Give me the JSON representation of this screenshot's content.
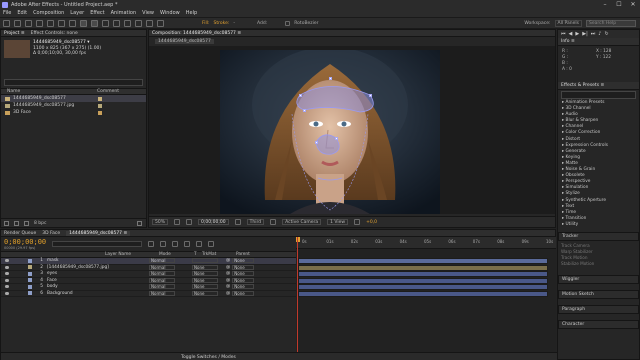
{
  "app": {
    "title": "Adobe After Effects - Untitled Project.aep *",
    "window_controls": [
      "–",
      "☐",
      "✕"
    ]
  },
  "menu": [
    "File",
    "Edit",
    "Composition",
    "Layer",
    "Effect",
    "Animation",
    "View",
    "Window",
    "Help"
  ],
  "toolbar": {
    "fill_label": "Fill:",
    "stroke_label": "Stroke:",
    "stroke_value": "-",
    "add_label": "Add:",
    "rotobezier_label": "RotoBezier",
    "workspace_label": "Workspace:",
    "workspace_value": "All Panels",
    "search_placeholder": "Search Help"
  },
  "project_panel": {
    "tabs": [
      "Project ≡",
      "Effect Controls: none"
    ],
    "selected_name": "1444685949_dsc08577 ▾",
    "selected_info1": "1100 x 825  (367 x 275) (1.00)",
    "selected_info2": "Δ 0;00;10;00, 30,00 fps",
    "col_name": "Name",
    "col_comment": "Comment",
    "items": [
      {
        "name": "1444685949_dsc08577",
        "color": "#c9b27a",
        "selected": true
      },
      {
        "name": "1444685949_dsc08577.jpg",
        "color": "#b6a87a",
        "selected": false
      },
      {
        "name": "3D Face",
        "color": "#c9a05a",
        "selected": false
      }
    ],
    "footer_bpc": "8 bpc"
  },
  "composition_panel": {
    "tab": "Composition: 1444685949_dsc08577 ≡",
    "subtab": "1444685949_dsc08577",
    "zoom": "50%",
    "timecode": "0;00;00;00",
    "resolution": "Third",
    "camera": "Active Camera",
    "views": "1 View",
    "exposure": "+0,0"
  },
  "right_panel": {
    "search_placeholder": "Search Help",
    "info_tab": "Info ≡",
    "info_rows": [
      {
        "k": "R :",
        "v": "X : 128"
      },
      {
        "k": "G :",
        "v": "Y : 122"
      },
      {
        "k": "B :",
        "v": ""
      },
      {
        "k": "A : 0",
        "v": ""
      }
    ],
    "effects_tab": "Effects & Presets ≡",
    "effects": [
      "Animation Presets",
      "3D Channel",
      "Audio",
      "Blur & Sharpen",
      "Channel",
      "Color Correction",
      "Distort",
      "Expression Controls",
      "Generate",
      "Keying",
      "Matte",
      "Noise & Grain",
      "Obsolete",
      "Perspective",
      "Simulation",
      "Stylize",
      "Synthetic Aperture",
      "Text",
      "Time",
      "Transition",
      "Utility"
    ],
    "tracker_tab": "Tracker",
    "tracker_rows": [
      "Track Camera",
      "Warp Stabilizer",
      "Track Motion",
      "Stabilize Motion"
    ],
    "sub_panels": [
      "Wiggler",
      "Motion Sketch",
      "Paragraph",
      "Character"
    ]
  },
  "timeline": {
    "tabs": [
      "Render Queue",
      "3D Face",
      "1444685949_dsc08577 ≡"
    ],
    "timecode": "0;00;00;00",
    "frames": "00000 (29.97 fps)",
    "search_placeholder": "",
    "columns": [
      "Layer Name",
      "Mode",
      "T",
      "TrkMat",
      "Parent"
    ],
    "layers": [
      {
        "num": "1",
        "name": "mask",
        "mode": "Normal",
        "trkmat": "",
        "parent": "None",
        "color": "#8e9ec8",
        "selected": true
      },
      {
        "num": "2",
        "name": "[1444685949_dsc08577.jpg]",
        "mode": "Normal",
        "trkmat": "None",
        "parent": "None",
        "color": "#b6a87a",
        "selected": false
      },
      {
        "num": "3",
        "name": "eyes",
        "mode": "Normal",
        "trkmat": "None",
        "parent": "None",
        "color": "#8e9ec8",
        "selected": false
      },
      {
        "num": "4",
        "name": "Face",
        "mode": "Normal",
        "trkmat": "None",
        "parent": "None",
        "color": "#8e9ec8",
        "selected": false
      },
      {
        "num": "5",
        "name": "body",
        "mode": "Normal",
        "trkmat": "None",
        "parent": "None",
        "color": "#8e9ec8",
        "selected": false
      },
      {
        "num": "6",
        "name": "Background",
        "mode": "Normal",
        "trkmat": "None",
        "parent": "None",
        "color": "#8e9ec8",
        "selected": false
      }
    ],
    "ruler": [
      "0s",
      "01s",
      "02s",
      "03s",
      "04s",
      "05s",
      "06s",
      "07s",
      "08s",
      "09s",
      "10s"
    ],
    "footer": "Toggle Switches / Modes"
  }
}
